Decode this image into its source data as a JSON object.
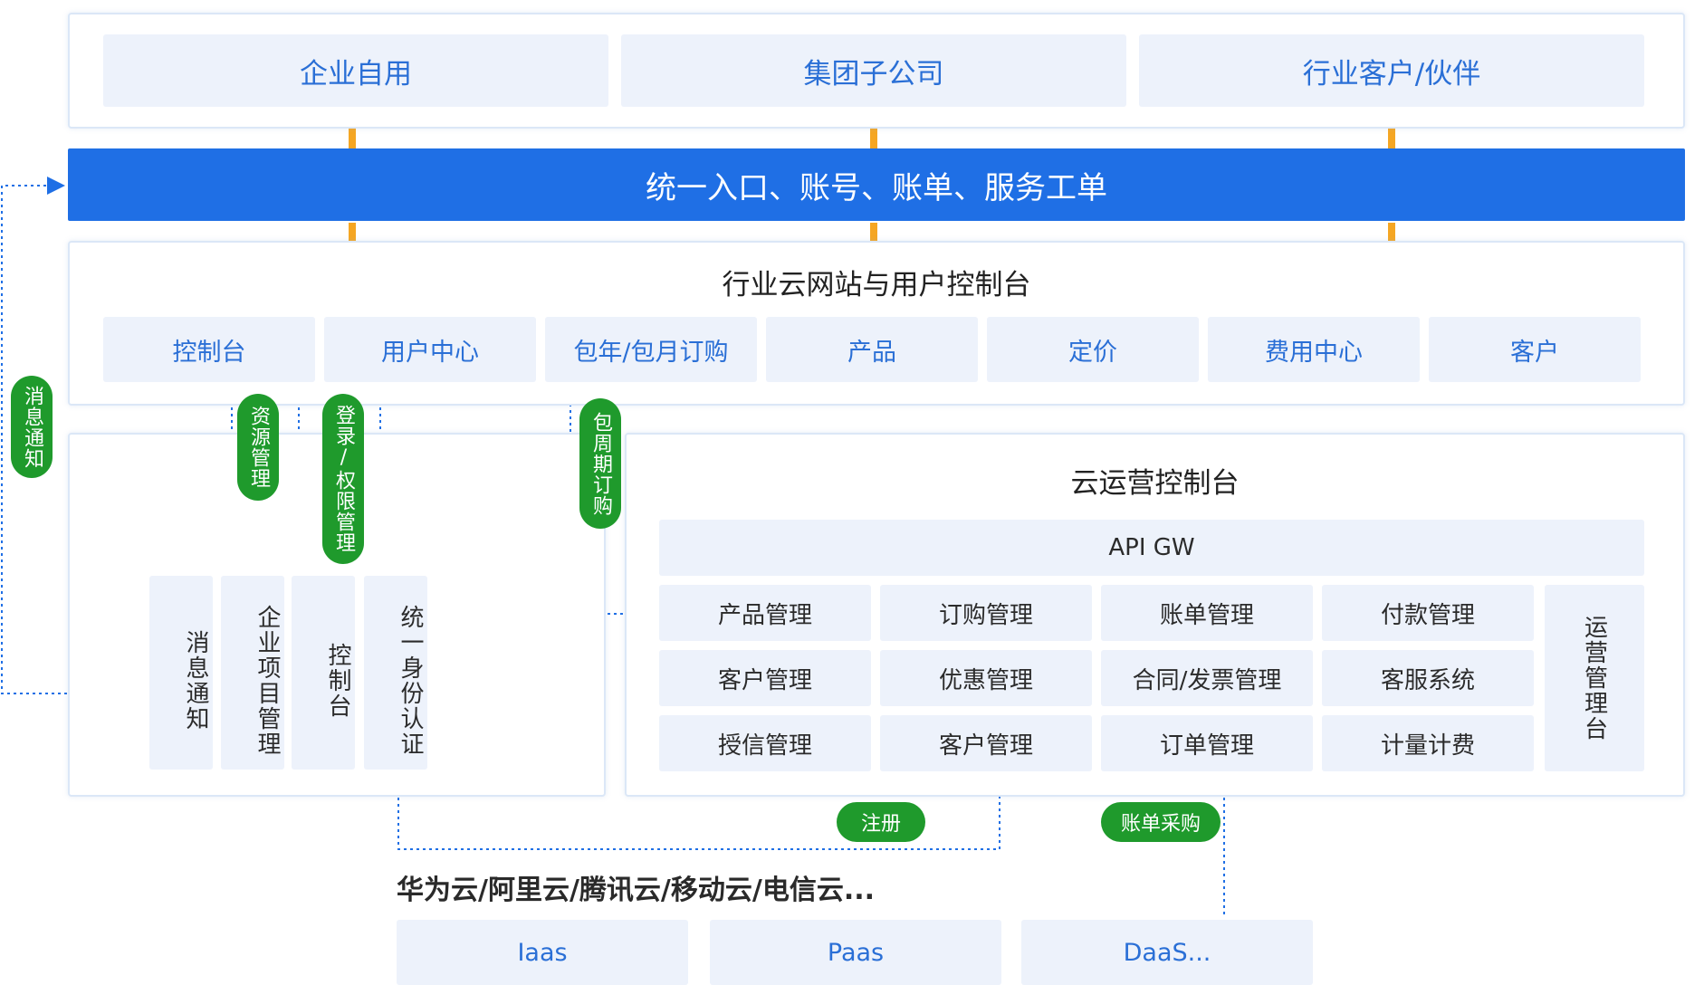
{
  "top_targets": [
    "企业自用",
    "集团子公司",
    "行业客户/伙伴"
  ],
  "unified_bar": "统一入口、账号、账单、服务工单",
  "portal": {
    "title": "行业云网站与用户控制台",
    "items": [
      "控制台",
      "用户中心",
      "包年/包月订购",
      "产品",
      "定价",
      "费用中心",
      "客户"
    ]
  },
  "left_panel": {
    "columns": [
      "消息通知",
      "企业项目管理",
      "控制台",
      "统一身份认证"
    ]
  },
  "ops": {
    "title": "云运营控制台",
    "api_gw": "API GW",
    "grid": [
      [
        "产品管理",
        "订购管理",
        "账单管理",
        "付款管理"
      ],
      [
        "客户管理",
        "优惠管理",
        "合同/发票管理",
        "客服系统"
      ],
      [
        "授信管理",
        "客户管理",
        "订单管理",
        "计量计费"
      ]
    ],
    "side": "运营管理台"
  },
  "pills": {
    "msg": "消息通知",
    "resource": "资源管理",
    "login": "登录/权限管理",
    "cycle": "包周期订购",
    "register": "注册",
    "bill_purchase": "账单采购"
  },
  "providers": {
    "title": "华为云/阿里云/腾讯云/移动云/电信云...",
    "items": [
      "Iaas",
      "Paas",
      "DaaS..."
    ]
  },
  "colors": {
    "accent": "#1f6fe5",
    "arrow": "#f5a623",
    "pill": "#1f9a2c",
    "cell": "#edf2fb",
    "link": "#1f6fe5"
  }
}
